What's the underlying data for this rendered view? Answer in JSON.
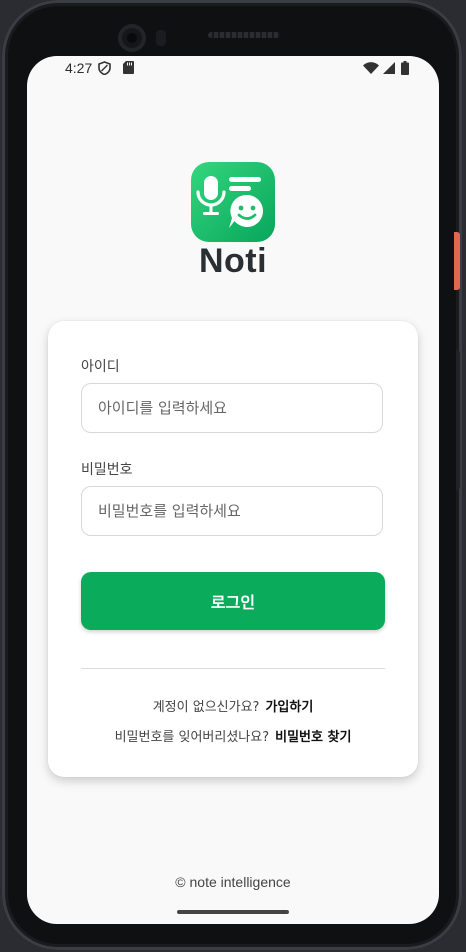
{
  "status_bar": {
    "time": "4:27"
  },
  "app": {
    "name": "Noti"
  },
  "form": {
    "id_label": "아이디",
    "id_placeholder": "아이디를 입력하세요",
    "password_label": "비밀번호",
    "password_placeholder": "비밀번호를 입력하세요",
    "login_label": "로그인"
  },
  "links": {
    "signup_prompt": "계정이 없으신가요?",
    "signup_link": "가입하기",
    "forgot_prompt": "비밀번호를 잊어버리셨나요?",
    "forgot_link": "비밀번호 찾기"
  },
  "footer": {
    "text": "© note intelligence"
  },
  "colors": {
    "accent": "#0aab5a",
    "logo_start": "#2ed47a",
    "logo_end": "#08a85c"
  }
}
